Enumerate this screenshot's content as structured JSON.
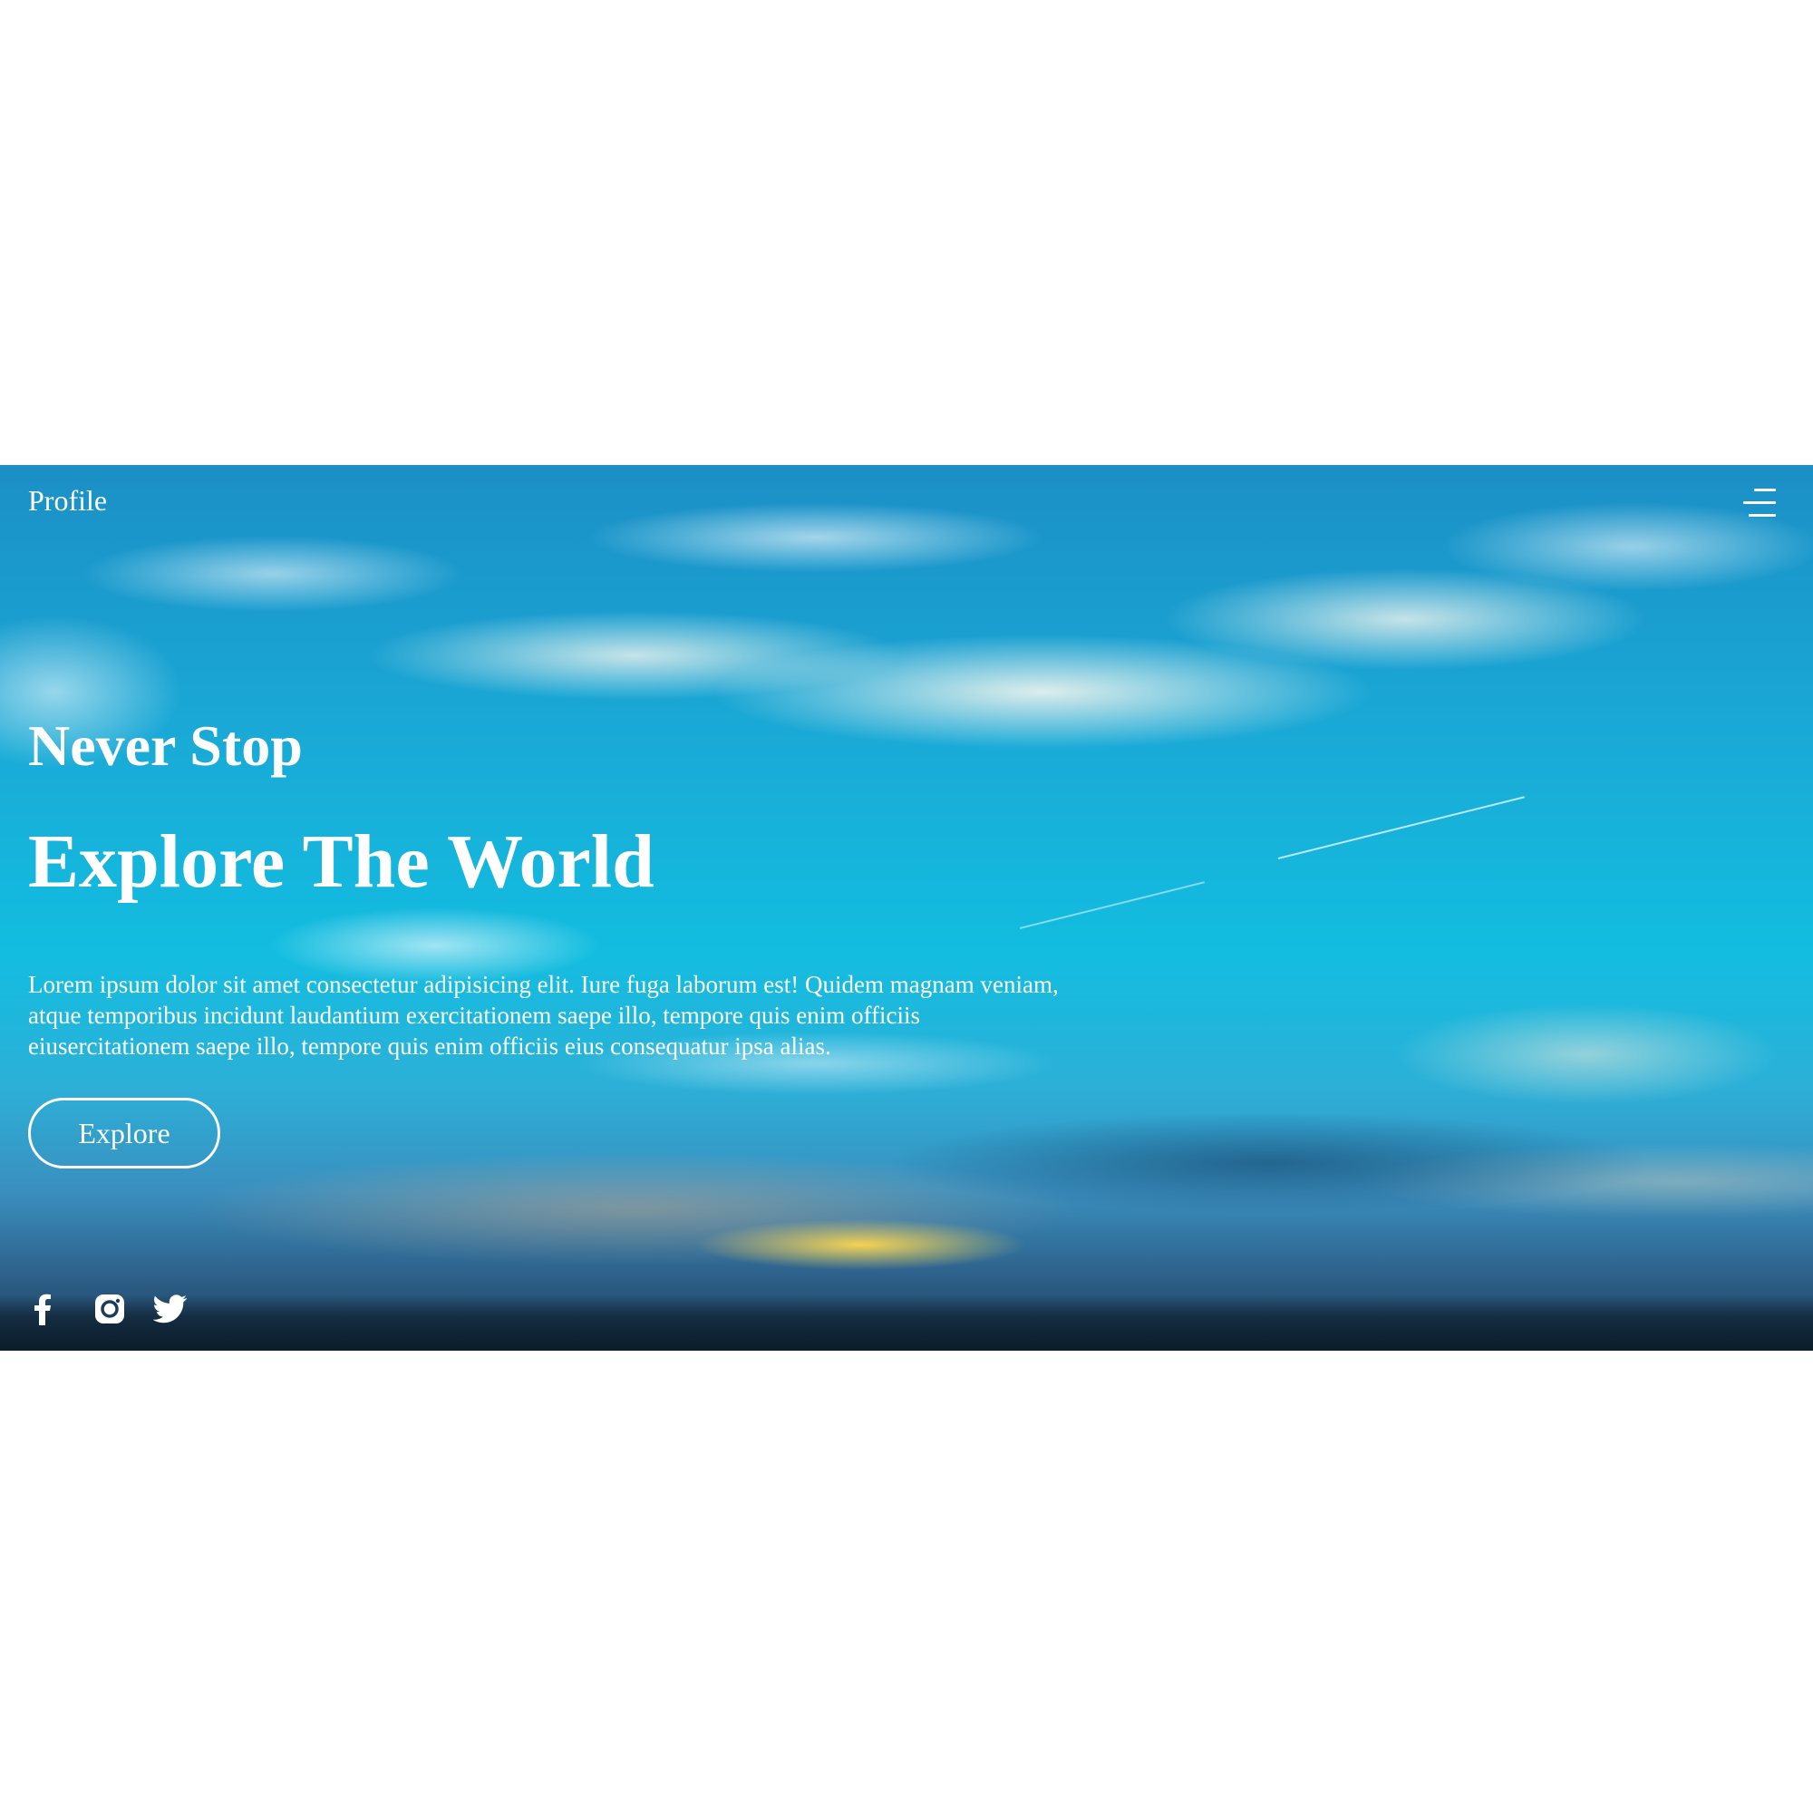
{
  "brand": "Profile",
  "hero": {
    "subtitle": "Never Stop",
    "title": "Explore The World",
    "description": "Lorem ipsum dolor sit amet consectetur adipisicing elit. Iure fuga laborum est! Quidem magnam veniam, atque temporibus incidunt laudantium exercitationem saepe illo, tempore quis enim officiis eiusercitationem saepe illo, tempore quis enim officiis eius consequatur ipsa alias.",
    "cta_label": "Explore"
  },
  "menu": {
    "icon": "hamburger-menu-icon"
  },
  "socials": [
    {
      "icon": "facebook-icon"
    },
    {
      "icon": "instagram-icon"
    },
    {
      "icon": "twitter-icon"
    }
  ],
  "colors": {
    "text": "#ffffff",
    "page_background": "#ffffff",
    "sky": "#12bde0"
  }
}
